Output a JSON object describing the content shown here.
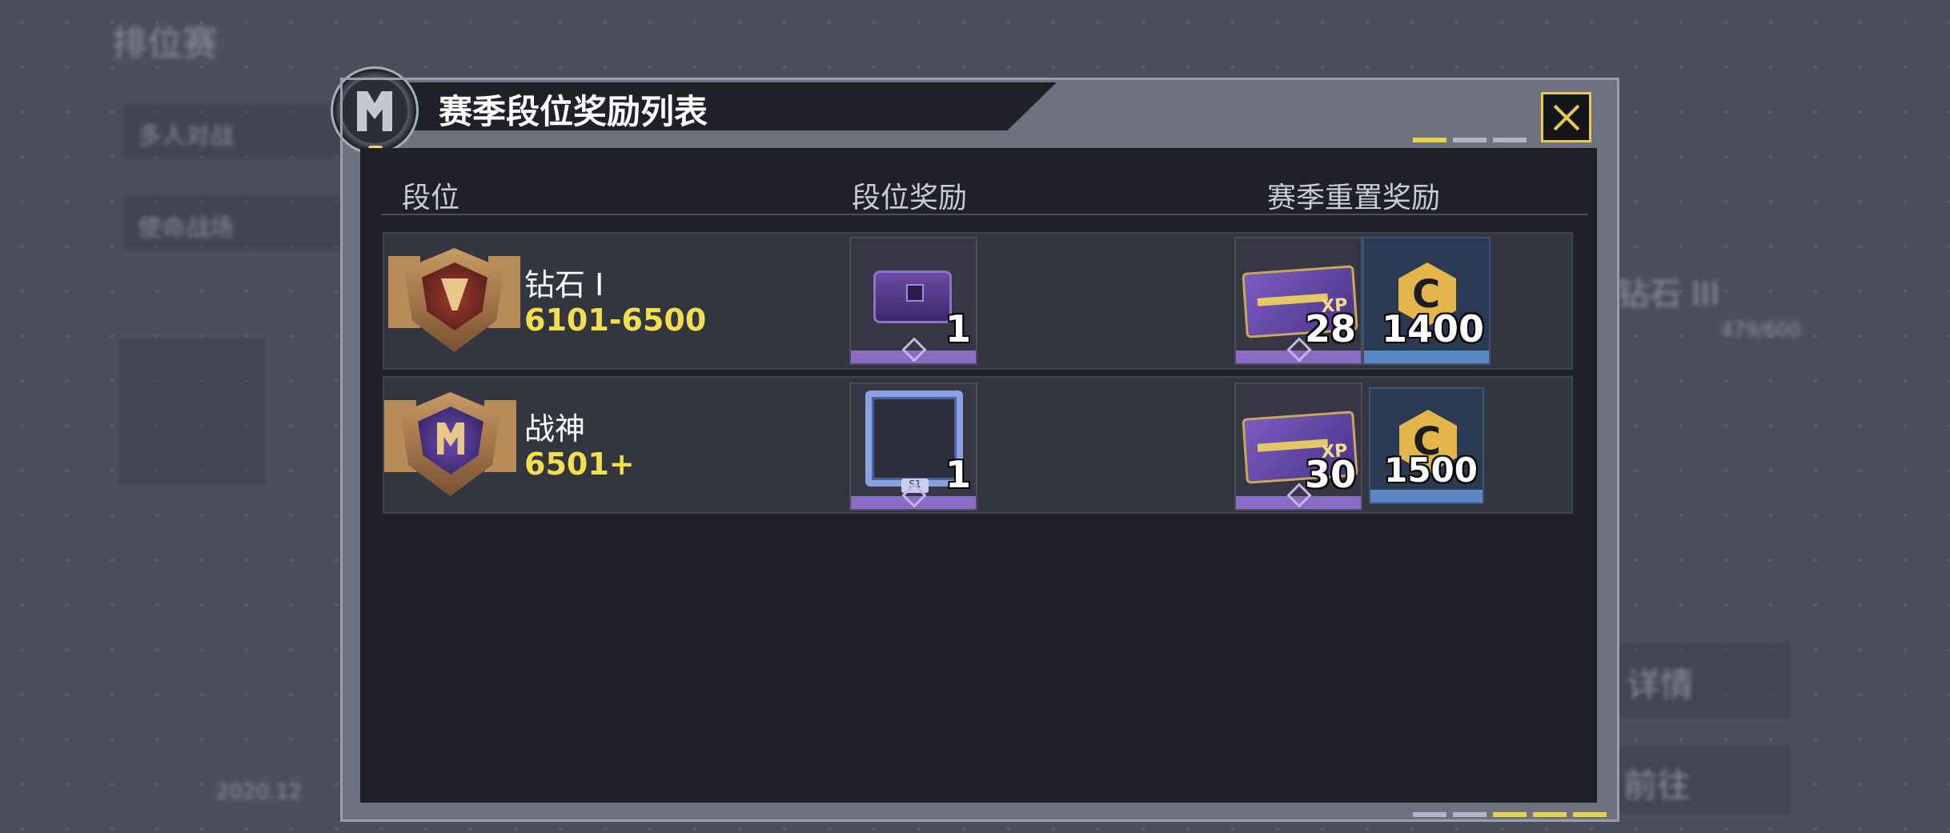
{
  "background": {
    "page_title": "排位赛",
    "tabs": [
      "多人对战",
      "使命战场"
    ],
    "rank_label": "钻石 III",
    "progress": "479/600",
    "details_button": "详情",
    "go_button": "前往",
    "season_date": "2020.12"
  },
  "modal": {
    "title": "赛季段位奖励列表",
    "close_icon": "close-x-icon",
    "columns": {
      "rank": "段位",
      "rank_reward": "段位奖励",
      "reset_reward": "赛季重置奖励"
    },
    "rows": [
      {
        "rank_name": "钻石 I",
        "score": "6101-6500",
        "rank_icon": "diamond-rank-medal-icon",
        "rank_reward": {
          "icon": "weapon-crate-icon",
          "qty": "1"
        },
        "reset_rewards": [
          {
            "icon": "weapon-xp-card-icon",
            "qty": "28"
          },
          {
            "icon": "cod-points-coin-icon",
            "qty": "1400"
          }
        ]
      },
      {
        "rank_name": "战神",
        "score": "6501+",
        "rank_icon": "legendary-rank-medal-icon",
        "rank_reward": {
          "icon": "avatar-frame-icon",
          "qty": "1",
          "tag": "S1"
        },
        "reset_rewards": [
          {
            "icon": "weapon-xp-card-icon",
            "qty": "30"
          },
          {
            "icon": "cod-points-coin-icon",
            "qty": "1500"
          }
        ]
      }
    ]
  },
  "colors": {
    "accent_yellow": "#f3de4e",
    "panel_dark": "#1f2028",
    "rarity_purple": "#8b6cc4",
    "rarity_blue": "#5c87c4"
  }
}
